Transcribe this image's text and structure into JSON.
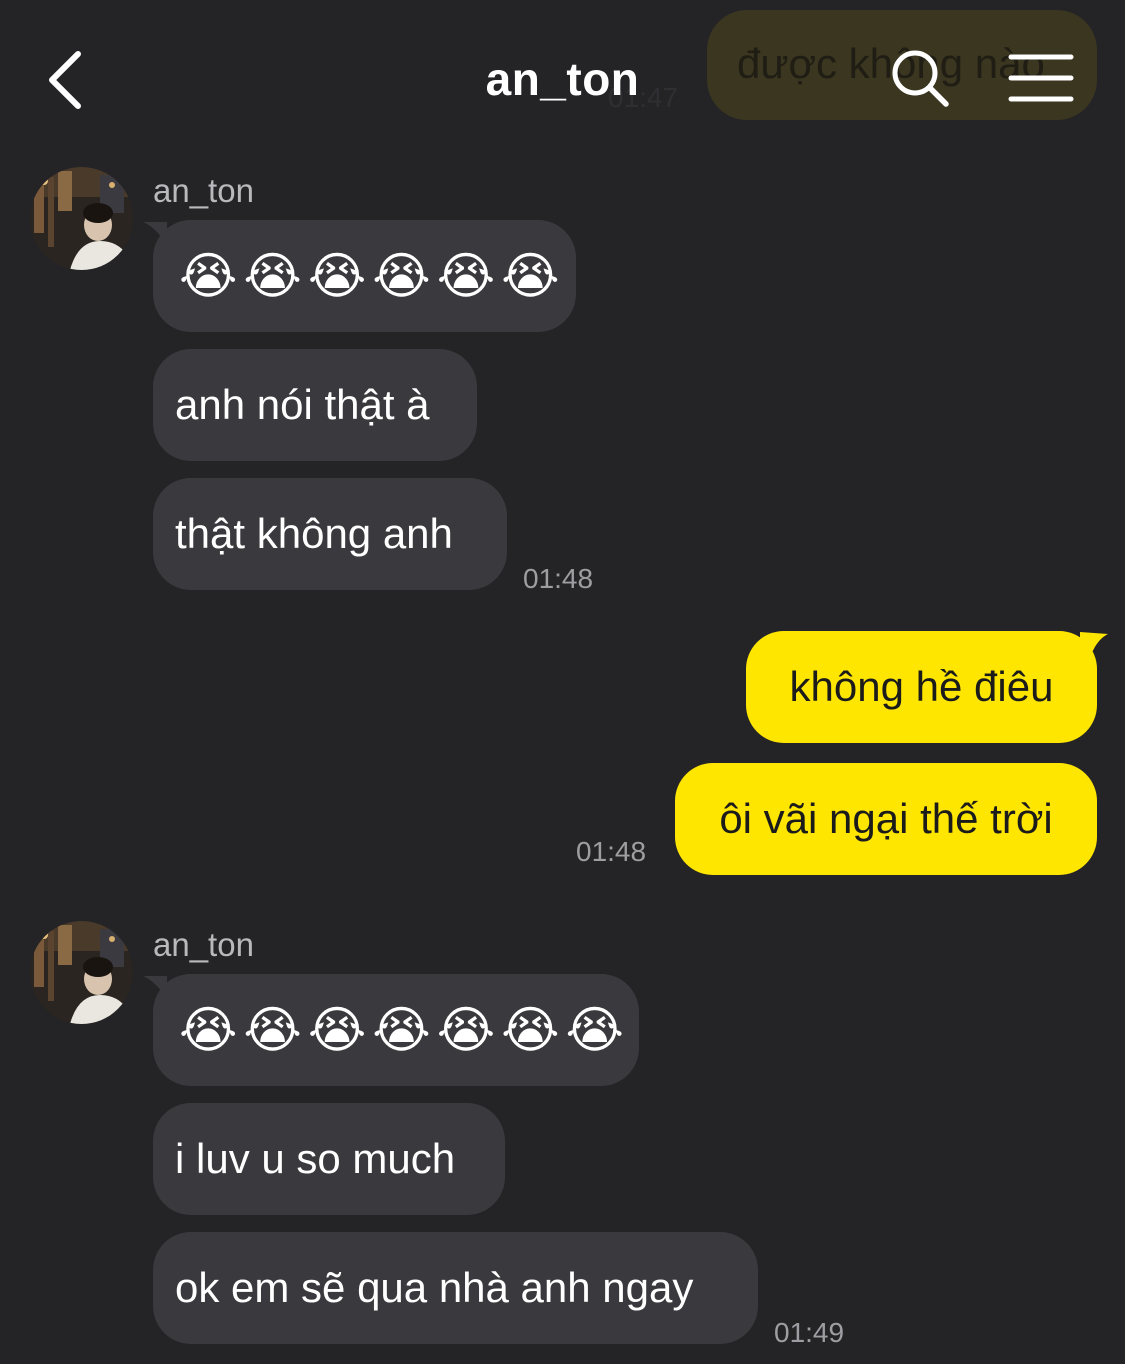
{
  "header": {
    "title": "an_ton",
    "ghost_message": "được không nào",
    "ghost_time": "01:47",
    "back_icon": "chevron-left-icon",
    "search_icon": "search-icon",
    "menu_icon": "menu-icon"
  },
  "colors": {
    "background": "#242427",
    "incoming_bubble": "#3a3a3e",
    "outgoing_bubble": "#ffe600",
    "timestamp": "#9d9da2"
  },
  "groups": [
    {
      "sender": "an_ton",
      "messages": [
        "😭😭😭😭😭😭",
        "anh nói thật à",
        "thật không anh"
      ],
      "time": "01:48"
    },
    {
      "sender": "me",
      "messages": [
        "không hề điêu",
        "ôi vãi ngại thế trời"
      ],
      "time": "01:48"
    },
    {
      "sender": "an_ton",
      "messages": [
        "😭😭😭😭😭😭😭",
        "i luv u so much",
        "ok em sẽ qua nhà anh ngay"
      ],
      "time": "01:49"
    }
  ]
}
